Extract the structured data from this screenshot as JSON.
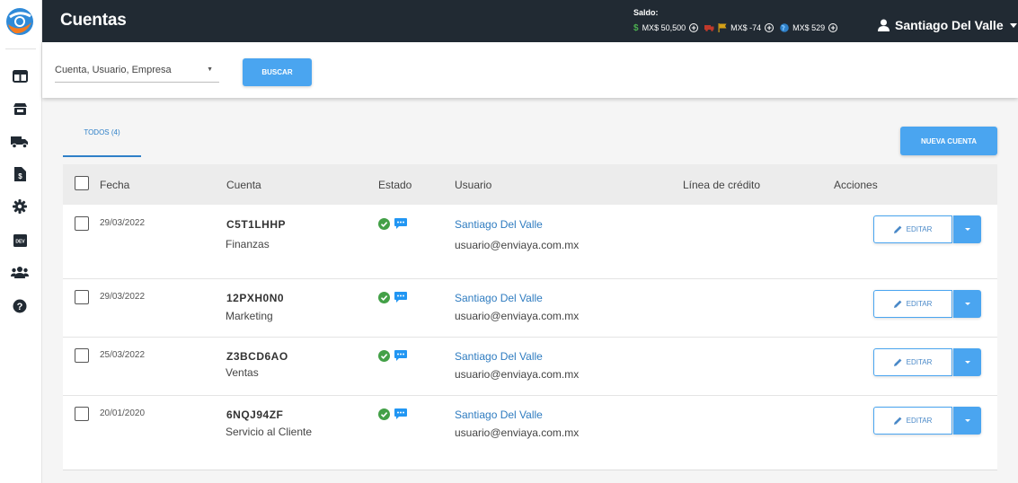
{
  "header": {
    "title": "Cuentas",
    "saldo_label": "Saldo:",
    "balances": [
      {
        "icon": "dollar-icon",
        "value": "MX$ 50,500",
        "color": "#4caf50"
      },
      {
        "icon": "dhl-truck-icon",
        "value": "MX$ -74",
        "color": "#c0392b"
      },
      {
        "icon": "globe-icon",
        "value": "MX$ 529",
        "color": "#2f80c8"
      }
    ],
    "user_name": "Santiago Del Valle"
  },
  "search": {
    "select_value": "Cuenta, Usuario, Empresa",
    "button_label": "BUSCAR"
  },
  "tabs": [
    {
      "label": "TODOS (4)",
      "active": true
    }
  ],
  "new_account_label": "NUEVA CUENTA",
  "table": {
    "columns": [
      "Fecha",
      "Cuenta",
      "Estado",
      "Usuario",
      "Línea de crédito",
      "Acciones"
    ],
    "rows": [
      {
        "date": "29/03/2022",
        "account": "C5T1LHHP",
        "department": "Finanzas",
        "user": "Santiago Del Valle",
        "email": "usuario@enviaya.com.mx",
        "credit_line": "",
        "action": "EDITAR"
      },
      {
        "date": "29/03/2022",
        "account": "12PXH0N0",
        "department": "Marketing",
        "user": "Santiago Del Valle",
        "email": "usuario@enviaya.com.mx",
        "credit_line": "",
        "action": "EDITAR"
      },
      {
        "date": "25/03/2022",
        "account": "Z3BCD6AO",
        "department": "Ventas",
        "user": "Santiago Del Valle",
        "email": "usuario@enviaya.com.mx",
        "credit_line": "",
        "action": "EDITAR"
      },
      {
        "date": "20/01/2020",
        "account": "6NQJ94ZF",
        "department": "Servicio al Cliente",
        "user": "Santiago Del Valle",
        "email": "usuario@enviaya.com.mx",
        "credit_line": "",
        "action": "EDITAR"
      }
    ]
  },
  "sidebar": {
    "items": [
      {
        "icon": "dashboard-icon"
      },
      {
        "icon": "store-icon"
      },
      {
        "icon": "truck-icon"
      },
      {
        "icon": "invoice-icon"
      },
      {
        "icon": "gear-icon"
      },
      {
        "icon": "dev-icon",
        "label": "DEV"
      },
      {
        "icon": "users-icon"
      },
      {
        "icon": "help-icon"
      }
    ]
  },
  "colors": {
    "topbar": "#212a33",
    "primary": "#4aa5f0",
    "link": "#2f7cc0",
    "status_ok": "#43a047",
    "status_msg": "#2196f3"
  }
}
